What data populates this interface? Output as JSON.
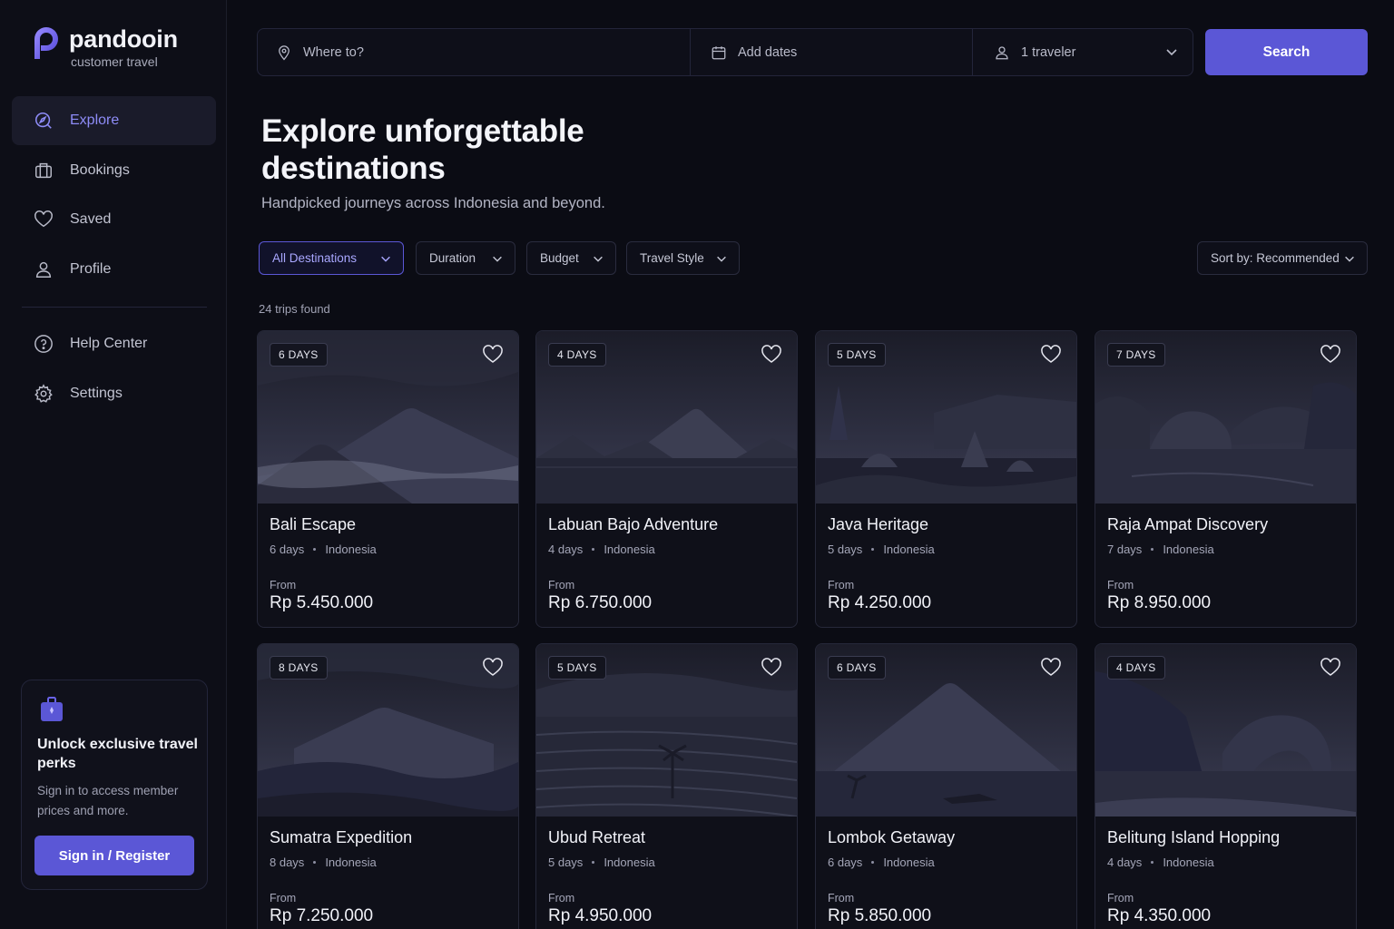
{
  "brand": {
    "name": "pandooin",
    "subtitle": "customer travel",
    "accent": "#5b57d6"
  },
  "nav": {
    "primary": [
      {
        "label": "Explore",
        "icon": "explore-icon",
        "active": true
      },
      {
        "label": "Bookings",
        "icon": "briefcase-icon",
        "active": false
      },
      {
        "label": "Saved",
        "icon": "heart-icon",
        "active": false
      },
      {
        "label": "Profile",
        "icon": "user-icon",
        "active": false
      }
    ],
    "secondary": [
      {
        "label": "Help Center",
        "icon": "help-icon"
      },
      {
        "label": "Settings",
        "icon": "gear-icon"
      }
    ]
  },
  "promo": {
    "title": "Unlock exclusive travel perks",
    "text": "Sign in to access member prices and more.",
    "button": "Sign in / Register"
  },
  "search": {
    "where_placeholder": "Where to?",
    "dates_placeholder": "Add dates",
    "travelers": "1 traveler",
    "button": "Search"
  },
  "hero": {
    "title": "Explore unforgettable destinations",
    "subtitle": "Handpicked journeys across Indonesia and beyond."
  },
  "filters": {
    "destinations": "All Destinations",
    "duration": "Duration",
    "budget": "Budget",
    "style": "Travel Style",
    "sort": "Sort by: Recommended"
  },
  "results_count": "24 trips found",
  "price_prefix": "From",
  "trips": [
    {
      "badge": "6 DAYS",
      "title": "Bali Escape",
      "days": "6 days",
      "country": "Indonesia",
      "price": "Rp 5.450.000",
      "scene": "volcano-mist"
    },
    {
      "badge": "4 DAYS",
      "title": "Labuan Bajo Adventure",
      "days": "4 days",
      "country": "Indonesia",
      "price": "Rp 6.750.000",
      "scene": "island-peak"
    },
    {
      "badge": "5 DAYS",
      "title": "Java Heritage",
      "days": "5 days",
      "country": "Indonesia",
      "price": "Rp 4.250.000",
      "scene": "temple"
    },
    {
      "badge": "7 DAYS",
      "title": "Raja Ampat Discovery",
      "days": "7 days",
      "country": "Indonesia",
      "price": "Rp 8.950.000",
      "scene": "karst-islands"
    },
    {
      "badge": "8 DAYS",
      "title": "Sumatra Expedition",
      "days": "8 days",
      "country": "Indonesia",
      "price": "Rp 7.250.000",
      "scene": "volcano-valley"
    },
    {
      "badge": "5 DAYS",
      "title": "Ubud Retreat",
      "days": "5 days",
      "country": "Indonesia",
      "price": "Rp 4.950.000",
      "scene": "rice-terraces"
    },
    {
      "badge": "6 DAYS",
      "title": "Lombok Getaway",
      "days": "6 days",
      "country": "Indonesia",
      "price": "Rp 5.850.000",
      "scene": "volcano-lake"
    },
    {
      "badge": "4 DAYS",
      "title": "Belitung Island Hopping",
      "days": "4 days",
      "country": "Indonesia",
      "price": "Rp 4.350.000",
      "scene": "rock-arch-coast"
    }
  ]
}
